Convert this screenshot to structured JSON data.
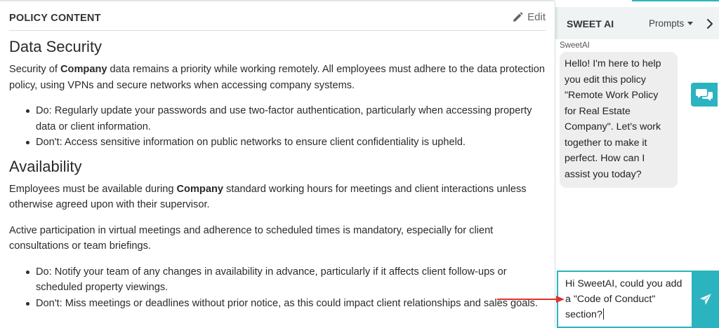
{
  "policy": {
    "header_title": "POLICY CONTENT",
    "edit_label": "Edit",
    "sections": [
      {
        "heading": "Data Security",
        "intro_pre": "Security of ",
        "intro_bold": "Company",
        "intro_post": " data remains a priority while working remotely. All employees must adhere to the data protection policy, using VPNs and secure networks when accessing company systems.",
        "bullets": [
          "Do: Regularly update your passwords and use two-factor authentication, particularly when accessing property data or client information.",
          "Don't: Access sensitive information on public networks to ensure client confidentiality is upheld."
        ]
      },
      {
        "heading": "Availability",
        "intro_pre": "Employees must be available during ",
        "intro_bold": "Company",
        "intro_post": " standard working hours for meetings and client interactions unless otherwise agreed upon with their supervisor.",
        "para2": "Active participation in virtual meetings and adherence to scheduled times is mandatory, especially for client consultations or team briefings.",
        "bullets": [
          "Do: Notify your team of any changes in availability in advance, particularly if it affects client follow-ups or scheduled property viewings.",
          "Don't: Miss meetings or deadlines without prior notice, as this could impact client relationships and sales goals."
        ]
      }
    ]
  },
  "ai": {
    "title": "SWEET AI",
    "prompts_label": "Prompts",
    "sender": "SweetAI",
    "message": "Hello! I'm here to help you edit this policy \"Remote Work Policy for Real Estate Company\". Let's work together to make it perfect. How can I assist you today?",
    "input_value": "Hi SweetAI, could you add a \"Code of Conduct\" section?"
  },
  "colors": {
    "accent": "#2bb3c0",
    "annotation_arrow": "#e0312a"
  },
  "icons": {
    "edit": "pencil-icon",
    "collapse": "chevron-right-icon",
    "chat": "chat-bubbles-icon",
    "send": "paper-plane-icon"
  }
}
